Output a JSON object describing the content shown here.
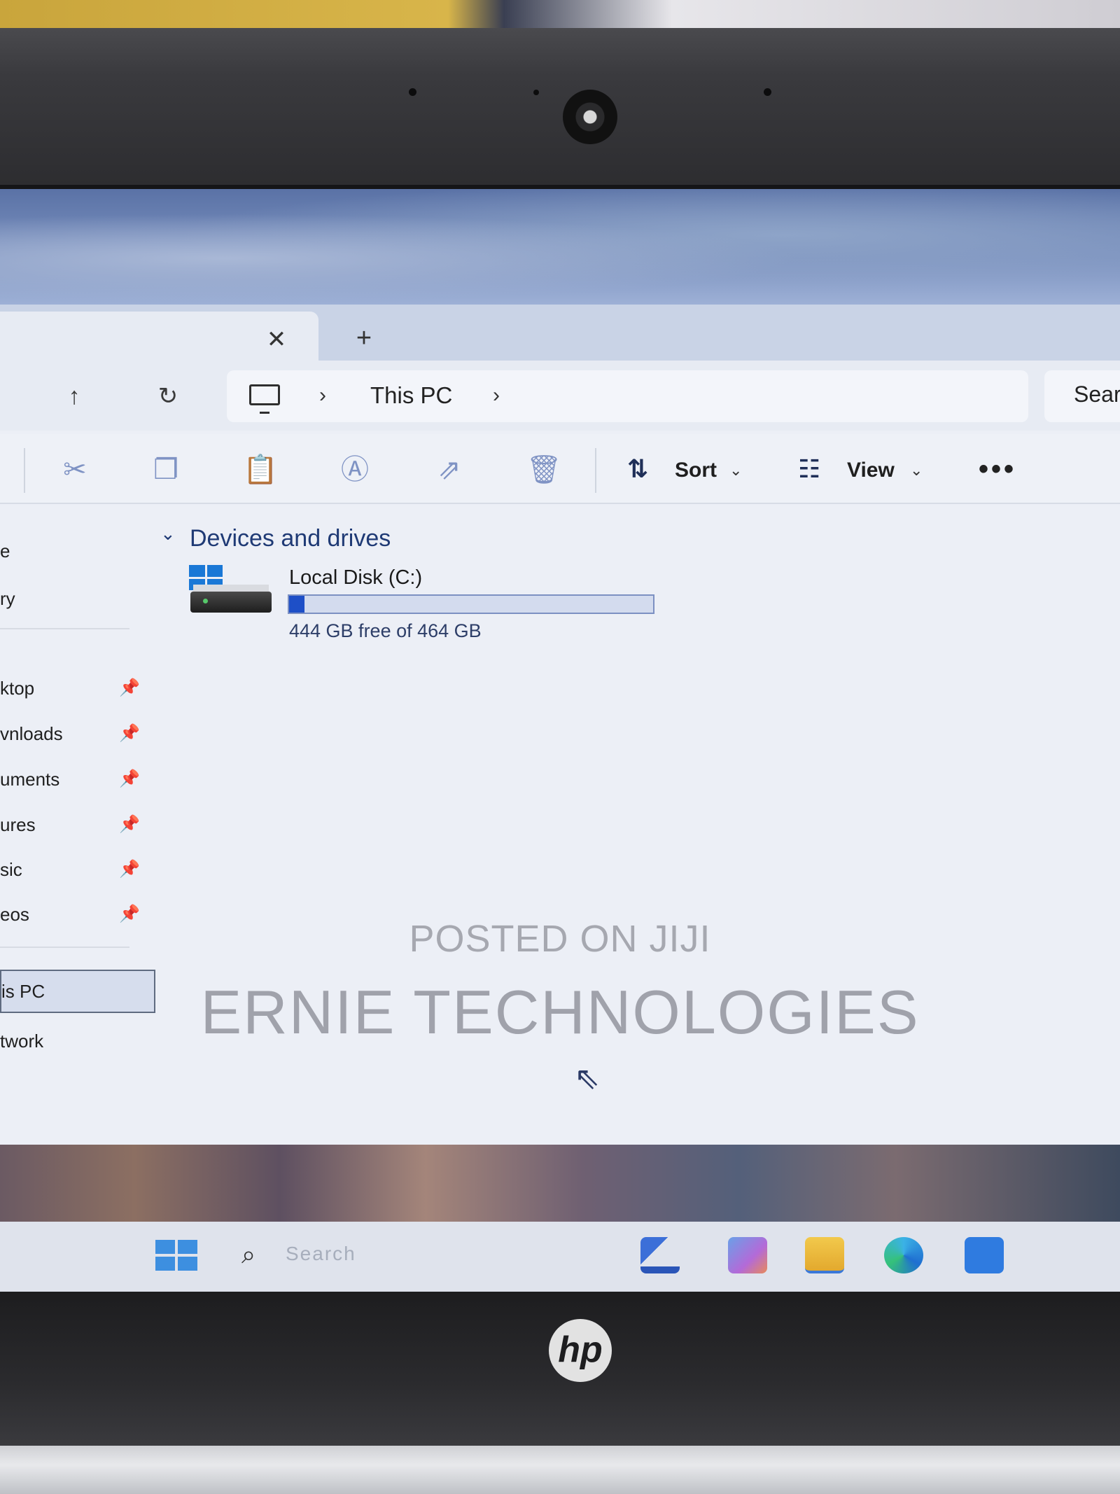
{
  "tabs": {
    "close_glyph": "✕",
    "new_glyph": "+"
  },
  "nav": {
    "up_glyph": "↑",
    "refresh_glyph": "↻",
    "breadcrumb": [
      "This PC"
    ],
    "chevron_glyph": "›",
    "search_label": "Sear"
  },
  "command_bar": {
    "sort_label": "Sort",
    "view_label": "View",
    "more_label": "•••",
    "icons": [
      "cut-icon",
      "copy-icon",
      "paste-icon",
      "rename-icon",
      "share-icon",
      "delete-icon"
    ]
  },
  "sidebar": {
    "items_top": [
      "e",
      "ry"
    ],
    "pinned": [
      "ktop",
      "vnloads",
      "uments",
      "ures",
      "sic",
      "eos"
    ],
    "pin_glyph": "📌",
    "items_bottom": [
      "is PC",
      "twork"
    ]
  },
  "content": {
    "section_title": "Devices and drives",
    "section_chevron": "⌄",
    "drives": [
      {
        "name": "Local Disk (C:)",
        "free_text": "444 GB free of 464 GB",
        "used_fraction": 0.043
      }
    ]
  },
  "watermark": {
    "line1": "POSTED ON JIJI",
    "line2": "ERNIE TECHNOLOGIES"
  },
  "taskbar": {
    "search_placeholder": "Search",
    "search_glyph": "⌕"
  },
  "laptop": {
    "brand_logo": "hp"
  },
  "colors": {
    "accent": "#1e4fc7",
    "section_title": "#1f3a75",
    "command_icon": "#7f93c4"
  }
}
